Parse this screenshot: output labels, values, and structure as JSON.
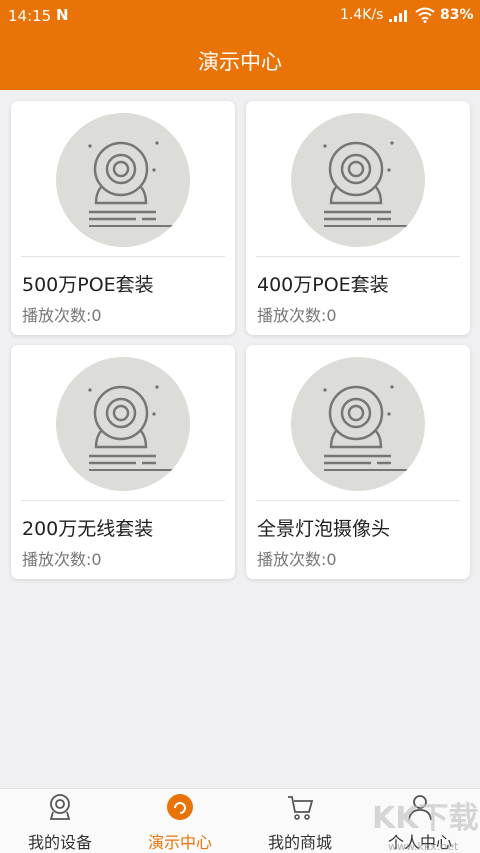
{
  "status_bar": {
    "time": "14:15",
    "notification_glyph": "N",
    "network_speed": "1.4K/s",
    "battery": "83%"
  },
  "header": {
    "title": "演示中心",
    "background_color": "#e97307"
  },
  "cards": [
    {
      "name": "500万POE套装",
      "plays": "播放次数:0",
      "icon": "camera-illustration"
    },
    {
      "name": "400万POE套装",
      "plays": "播放次数:0",
      "icon": "camera-illustration"
    },
    {
      "name": "200万无线套装",
      "plays": "播放次数:0",
      "icon": "camera-illustration"
    },
    {
      "name": "全景灯泡摄像头",
      "plays": "播放次数:0",
      "icon": "camera-illustration"
    }
  ],
  "tabbar": {
    "active_color": "#e97307",
    "tabs": [
      {
        "label": "我的设备",
        "icon": "device-camera-icon"
      },
      {
        "label": "演示中心",
        "icon": "demo-center-icon"
      },
      {
        "label": "我的商城",
        "icon": "cart-icon"
      },
      {
        "label": "个人中心",
        "icon": "person-icon"
      }
    ]
  },
  "watermark": {
    "text": "KK下载",
    "url": "www.kkx.net"
  }
}
